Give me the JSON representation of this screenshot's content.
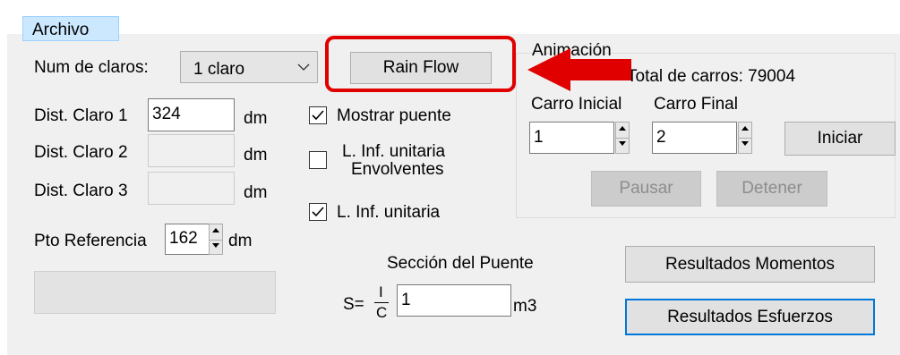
{
  "menu": {
    "archivo": "Archivo"
  },
  "claros": {
    "label": "Num de claros:",
    "selected": "1 claro"
  },
  "rain_flow_button": "Rain Flow",
  "distances": [
    {
      "label": "Dist. Claro 1",
      "value": "324",
      "unit": "dm"
    },
    {
      "label": "Dist. Claro 2",
      "value": "",
      "unit": "dm"
    },
    {
      "label": "Dist. Claro 3",
      "value": "",
      "unit": "dm"
    }
  ],
  "referencia": {
    "label": "Pto Referencia",
    "value": "162",
    "unit": "dm"
  },
  "checkboxes": {
    "mostrar_puente": {
      "label": "Mostrar puente",
      "checked": true
    },
    "envolventes": {
      "line1": "L. Inf. unitaria",
      "line2": "Envolventes",
      "checked": false
    },
    "unitaria": {
      "label": "L. Inf. unitaria",
      "checked": true
    }
  },
  "animacion": {
    "group_label": "Animación",
    "total_label": "Total de carros: 79004",
    "carro_inicial_label": "Carro Inicial",
    "carro_inicial_value": "1",
    "carro_final_label": "Carro Final",
    "carro_final_value": "2",
    "iniciar": "Iniciar",
    "pausar": "Pausar",
    "detener": "Detener"
  },
  "seccion": {
    "title": "Sección del Puente",
    "s_eq": "S=",
    "numerator": "I",
    "denominator": "C",
    "value": "1",
    "unit": "m3"
  },
  "results": {
    "momentos": "Resultados Momentos",
    "esfuerzos": "Resultados Esfuerzos"
  },
  "colors": {
    "highlight": "#e00000",
    "arrow": "#e00000",
    "menu_selected": "#cce8ff",
    "focus_border": "#0078d7"
  }
}
